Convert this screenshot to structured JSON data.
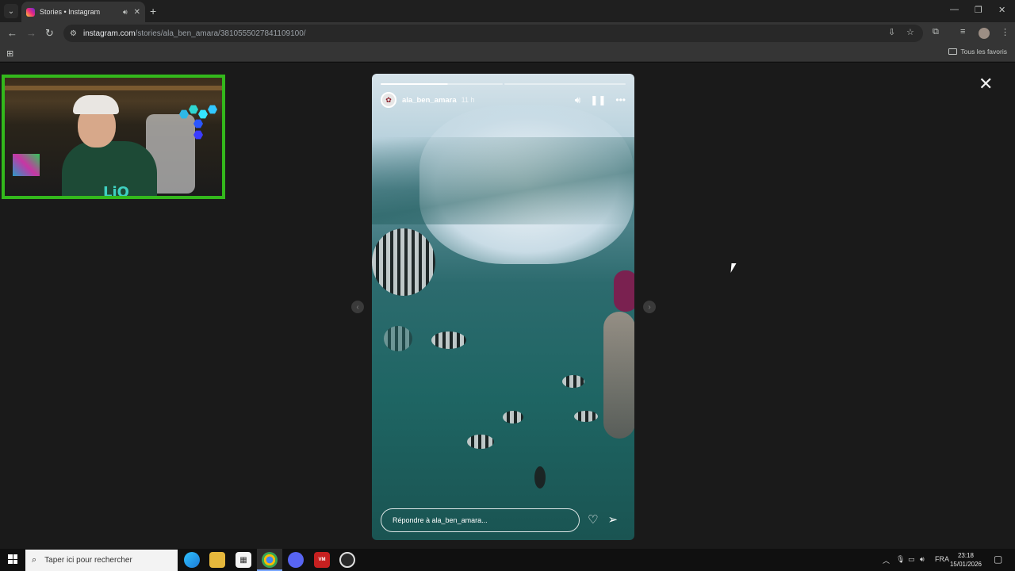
{
  "browser": {
    "tab": {
      "title": "Stories • Instagram"
    },
    "address": {
      "host": "instagram.com",
      "path": "/stories/ala_ben_amara/3810555027841109100/"
    },
    "bookmarks": {
      "folder_label": "Tous les favoris"
    }
  },
  "story": {
    "username": "ala_ben_amara",
    "time_ago": "11 h",
    "progress": {
      "segments": 2,
      "current": 1,
      "current_fill": 0.55
    },
    "reply_placeholder": "Répondre à ala_ben_amara..."
  },
  "overlay": {
    "logo_text": "LiO"
  },
  "taskbar": {
    "search_placeholder": "Taper ici pour rechercher",
    "language": "FRA",
    "time": "23:18",
    "date": "15/01/2026"
  },
  "icons": {
    "tab_sound": "speaker-icon",
    "close": "close-icon",
    "mute": "speaker-icon",
    "pause": "pause-icon",
    "more": "more-icon",
    "like": "heart-icon",
    "share": "send-icon"
  },
  "colors": {
    "webcam_border": "#33b81c",
    "page_bg": "#1a1a1a",
    "chrome_bg": "#353535"
  }
}
